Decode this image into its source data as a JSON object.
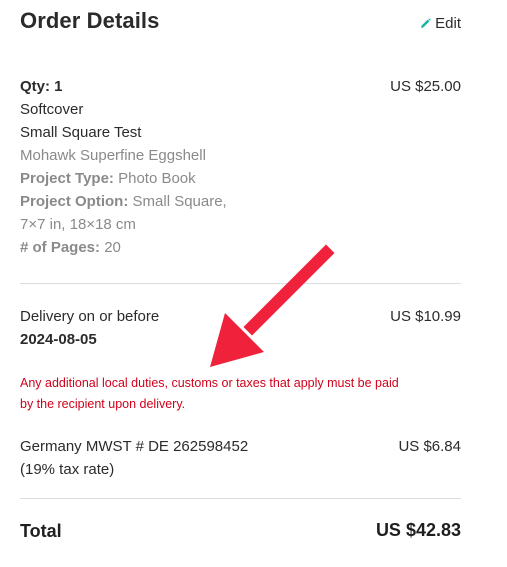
{
  "header": {
    "title": "Order Details",
    "edit_label": "Edit",
    "edit_icon": "pencil-icon",
    "edit_icon_color": "#19b3a6"
  },
  "item": {
    "qty": "Qty: 1",
    "price": "US $25.00",
    "cover": "Softcover",
    "name": "Small Square Test",
    "paper": "Mohawk Superfine Eggshell",
    "project_type_label": "Project Type:",
    "project_type_value": "Photo Book",
    "project_option_label": "Project Option:",
    "project_option_value": "Small Square,",
    "project_option_value_2": "7×7 in, 18×18 cm",
    "pages_label": "# of Pages:",
    "pages_value": "20"
  },
  "delivery": {
    "label": "Delivery on or before",
    "date": "2024-08-05",
    "price": "US $10.99",
    "notice_line1": "Any additional local duties, customs or taxes that apply must be paid",
    "notice_line2": "by the recipient upon delivery."
  },
  "tax": {
    "label": "Germany MWST # DE 262598452",
    "rate": "(19% tax rate)",
    "price": "US $6.84"
  },
  "total": {
    "label": "Total",
    "value": "US $42.83"
  },
  "colors": {
    "notice": "#d0021b",
    "annotation_arrow": "#f0213a"
  }
}
